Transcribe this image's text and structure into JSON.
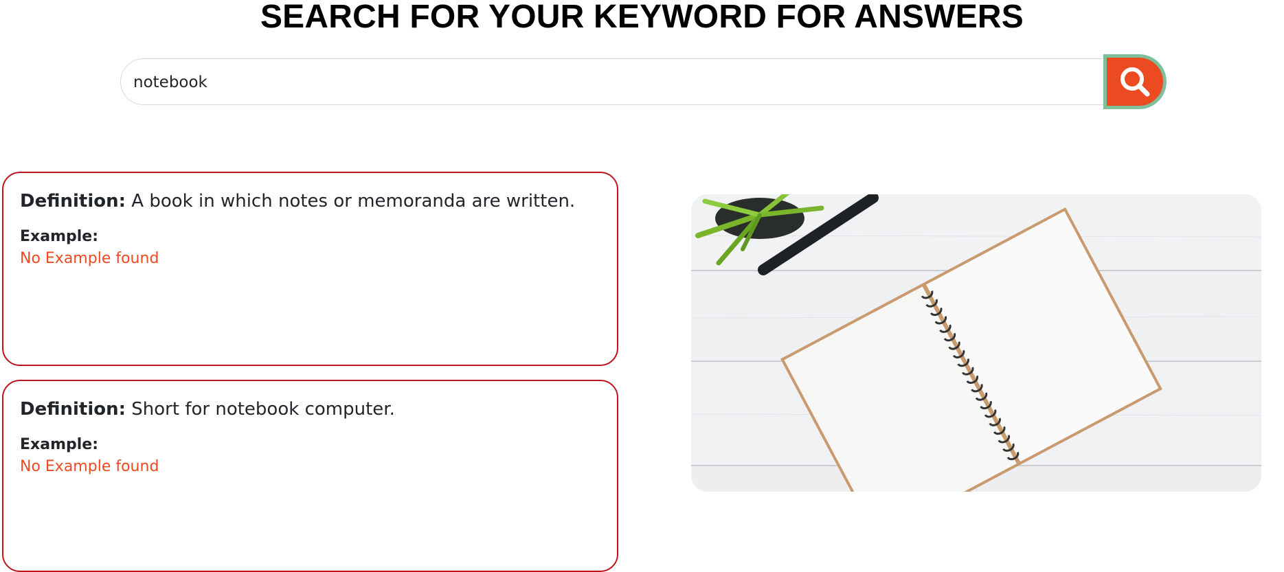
{
  "header": {
    "title": "SEARCH FOR YOUR KEYWORD FOR ANSWERS"
  },
  "search": {
    "value": "notebook",
    "button_icon": "search-icon"
  },
  "results": [
    {
      "definition_label": "Definition:",
      "definition_text": "A book in which notes or memoranda are written.",
      "example_label": "Example:",
      "example_text": "No Example found"
    },
    {
      "definition_label": "Definition:",
      "definition_text": "Short for notebook computer.",
      "example_label": "Example:",
      "example_text": "No Example found"
    }
  ],
  "colors": {
    "accent": "#ec4a20",
    "button_border": "#7fbf9a",
    "card_border": "#c0141c"
  },
  "image": {
    "subject": "open spiral notebook with pen and plant on white wood"
  }
}
